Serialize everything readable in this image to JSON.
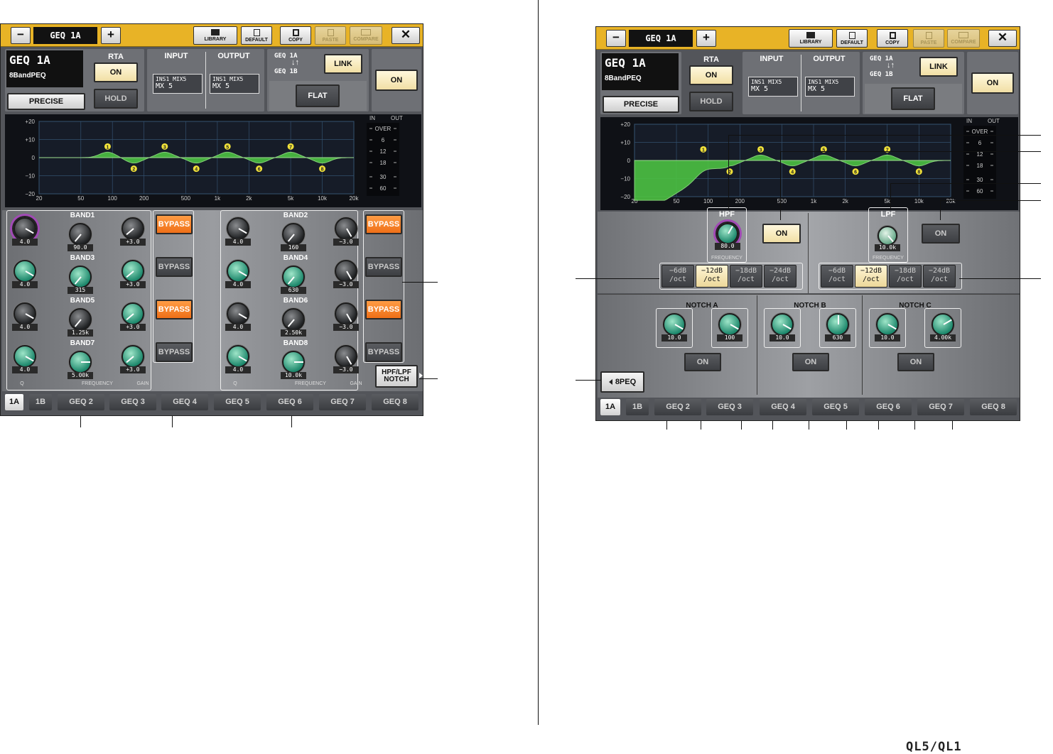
{
  "toolbar": {
    "minus": "−",
    "title": "GEQ 1A",
    "plus": "+",
    "library": "LIBRARY",
    "default": "DEFAULT",
    "copy": "COPY",
    "paste": "PASTE",
    "compare": "COMPARE",
    "close": "✕"
  },
  "header": {
    "eq_name": "GEQ 1A",
    "eq_type": "8BandPEQ",
    "precise": "PRECISE",
    "rta_label": "RTA",
    "rta_on": "ON",
    "hold": "HOLD",
    "input_label": "INPUT",
    "output_label": "OUTPUT",
    "input_port_1": "INS1 MIX5",
    "input_port_2": "MX 5",
    "output_port_1": "INS1 MIX5",
    "output_port_2": "MX 5",
    "link_top": "GEQ 1A",
    "link_bottom": "GEQ 1B",
    "link": "LINK",
    "flat": "FLAT",
    "on": "ON"
  },
  "graph": {
    "y_ticks": [
      "+20",
      "+10",
      "0",
      "−10",
      "−20"
    ],
    "x_ticks": [
      "20",
      "50",
      "100",
      "200",
      "500",
      "1k",
      "2k",
      "5k",
      "10k",
      "20k"
    ],
    "meter_in": "IN",
    "meter_out": "OUT",
    "meter_ticks": [
      "OVER",
      "6",
      "12",
      "18",
      "30",
      "60"
    ]
  },
  "left_screen": {
    "bands": [
      {
        "name": "BAND1",
        "q": "4.0",
        "freq": "90.0",
        "gain": "+3.0",
        "bypass": "BYPASS",
        "bypass_state": "on"
      },
      {
        "name": "BAND3",
        "q": "4.0",
        "freq": "315",
        "gain": "+3.0",
        "bypass": "BYPASS",
        "bypass_state": "off"
      },
      {
        "name": "BAND5",
        "q": "4.0",
        "freq": "1.25k",
        "gain": "+3.0",
        "bypass": "BYPASS",
        "bypass_state": "on"
      },
      {
        "name": "BAND7",
        "q": "4.0",
        "freq": "5.00k",
        "gain": "+3.0",
        "bypass": "BYPASS",
        "bypass_state": "off"
      },
      {
        "name": "BAND2",
        "q": "4.0",
        "freq": "160",
        "gain": "−3.0",
        "bypass": "BYPASS",
        "bypass_state": "on"
      },
      {
        "name": "BAND4",
        "q": "4.0",
        "freq": "630",
        "gain": "−3.0",
        "bypass": "BYPASS",
        "bypass_state": "off"
      },
      {
        "name": "BAND6",
        "q": "4.0",
        "freq": "2.50k",
        "gain": "−3.0",
        "bypass": "BYPASS",
        "bypass_state": "on"
      },
      {
        "name": "BAND8",
        "q": "4.0",
        "freq": "10.0k",
        "gain": "−3.0",
        "bypass": "BYPASS",
        "bypass_state": "off"
      }
    ],
    "col_q": "Q",
    "col_freq": "FREQUENCY",
    "col_gain": "GAIN",
    "switch_line1": "HPF/LPF",
    "switch_line2": "NOTCH"
  },
  "right_screen": {
    "hpf": {
      "label": "HPF",
      "freq": "80.0",
      "freq_label": "FREQUENCY",
      "on": "ON"
    },
    "lpf": {
      "label": "LPF",
      "freq": "10.0k",
      "freq_label": "FREQUENCY",
      "on": "ON"
    },
    "slopes": [
      {
        "value": "−6dB",
        "unit": "/oct"
      },
      {
        "value": "−12dB",
        "unit": "/oct"
      },
      {
        "value": "−18dB",
        "unit": "/oct"
      },
      {
        "value": "−24dB",
        "unit": "/oct"
      }
    ],
    "notches": [
      {
        "name": "NOTCH A",
        "q": "10.0",
        "freq": "100",
        "on": "ON"
      },
      {
        "name": "NOTCH B",
        "q": "10.0",
        "freq": "630",
        "on": "ON"
      },
      {
        "name": "NOTCH C",
        "q": "10.0",
        "freq": "4.00k",
        "on": "ON"
      }
    ],
    "back": "8PEQ"
  },
  "tabs": [
    "1A",
    "1B",
    "GEQ 2",
    "GEQ 3",
    "GEQ 4",
    "GEQ 5",
    "GEQ 6",
    "GEQ 7",
    "GEQ 8"
  ],
  "footer_logo": "QL5/QL1",
  "colors": {
    "accent": "#e8b326",
    "bypass_on": "#f07a20",
    "knob_teal": "#2aa884",
    "selected_ring": "#a14ab5",
    "curve": "#4cc142"
  }
}
